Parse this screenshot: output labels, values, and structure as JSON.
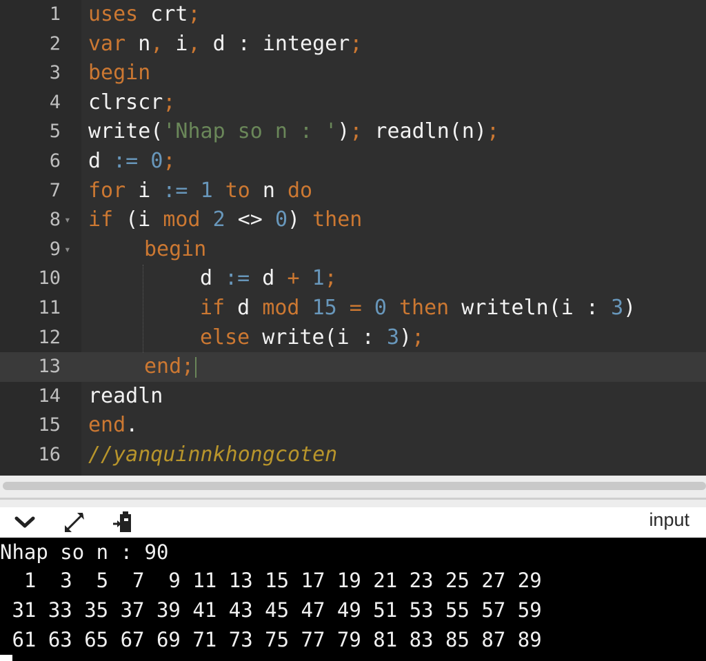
{
  "editor": {
    "lines": [
      {
        "number": "1",
        "fold": "",
        "active": false,
        "indent": 0,
        "tokens": [
          [
            "kw",
            "uses"
          ],
          [
            "plain",
            " crt"
          ],
          [
            "kw",
            ";"
          ]
        ]
      },
      {
        "number": "2",
        "fold": "",
        "active": false,
        "indent": 0,
        "tokens": [
          [
            "kw",
            "var"
          ],
          [
            "plain",
            " n"
          ],
          [
            "kw",
            ","
          ],
          [
            "plain",
            " i"
          ],
          [
            "kw",
            ","
          ],
          [
            "plain",
            " d : integer"
          ],
          [
            "kw",
            ";"
          ]
        ]
      },
      {
        "number": "3",
        "fold": "",
        "active": false,
        "indent": 0,
        "tokens": [
          [
            "kw",
            "begin"
          ]
        ]
      },
      {
        "number": "4",
        "fold": "",
        "active": false,
        "indent": 0,
        "tokens": [
          [
            "plain",
            "clrscr"
          ],
          [
            "kw",
            ";"
          ]
        ]
      },
      {
        "number": "5",
        "fold": "",
        "active": false,
        "indent": 0,
        "tokens": [
          [
            "plain",
            "write("
          ],
          [
            "str",
            "'Nhap so n : '"
          ],
          [
            "plain",
            ")"
          ],
          [
            "kw",
            ";"
          ],
          [
            "plain",
            " readln(n)"
          ],
          [
            "kw",
            ";"
          ]
        ]
      },
      {
        "number": "6",
        "fold": "",
        "active": false,
        "indent": 0,
        "tokens": [
          [
            "plain",
            "d "
          ],
          [
            "num",
            ":="
          ],
          [
            "plain",
            " "
          ],
          [
            "num",
            "0"
          ],
          [
            "kw",
            ";"
          ]
        ]
      },
      {
        "number": "7",
        "fold": "",
        "active": false,
        "indent": 0,
        "tokens": [
          [
            "kw",
            "for"
          ],
          [
            "plain",
            " i "
          ],
          [
            "num",
            ":="
          ],
          [
            "plain",
            " "
          ],
          [
            "num",
            "1"
          ],
          [
            "plain",
            " "
          ],
          [
            "kw",
            "to"
          ],
          [
            "plain",
            " n "
          ],
          [
            "kw",
            "do"
          ]
        ]
      },
      {
        "number": "8",
        "fold": "▾",
        "active": false,
        "indent": 0,
        "tokens": [
          [
            "kw",
            "if"
          ],
          [
            "plain",
            " (i "
          ],
          [
            "kw",
            "mod"
          ],
          [
            "plain",
            " "
          ],
          [
            "num",
            "2"
          ],
          [
            "plain",
            " <> "
          ],
          [
            "num",
            "0"
          ],
          [
            "plain",
            ") "
          ],
          [
            "kw",
            "then"
          ]
        ]
      },
      {
        "number": "9",
        "fold": "▾",
        "active": false,
        "indent": 1,
        "tokens": [
          [
            "kw",
            "begin"
          ]
        ]
      },
      {
        "number": "10",
        "fold": "",
        "active": false,
        "indent": 2,
        "tokens": [
          [
            "plain",
            "d "
          ],
          [
            "num",
            ":="
          ],
          [
            "plain",
            " d "
          ],
          [
            "kw",
            "+"
          ],
          [
            "plain",
            " "
          ],
          [
            "num",
            "1"
          ],
          [
            "kw",
            ";"
          ]
        ]
      },
      {
        "number": "11",
        "fold": "",
        "active": false,
        "indent": 2,
        "tokens": [
          [
            "kw",
            "if"
          ],
          [
            "plain",
            " d "
          ],
          [
            "kw",
            "mod"
          ],
          [
            "plain",
            " "
          ],
          [
            "num",
            "15"
          ],
          [
            "plain",
            " "
          ],
          [
            "kw",
            "="
          ],
          [
            "plain",
            " "
          ],
          [
            "num",
            "0"
          ],
          [
            "plain",
            " "
          ],
          [
            "kw",
            "then"
          ],
          [
            "plain",
            " writeln(i : "
          ],
          [
            "num",
            "3"
          ],
          [
            "plain",
            ")"
          ]
        ]
      },
      {
        "number": "12",
        "fold": "",
        "active": false,
        "indent": 2,
        "tokens": [
          [
            "kw",
            "else"
          ],
          [
            "plain",
            " write(i : "
          ],
          [
            "num",
            "3"
          ],
          [
            "plain",
            ")"
          ],
          [
            "kw",
            ";"
          ]
        ]
      },
      {
        "number": "13",
        "fold": "",
        "active": true,
        "indent": 1,
        "tokens": [
          [
            "kw",
            "end;"
          ]
        ]
      },
      {
        "number": "14",
        "fold": "",
        "active": false,
        "indent": 0,
        "tokens": [
          [
            "plain",
            "readln"
          ]
        ]
      },
      {
        "number": "15",
        "fold": "",
        "active": false,
        "indent": 0,
        "tokens": [
          [
            "kw",
            "end"
          ],
          [
            "plain",
            "."
          ]
        ]
      },
      {
        "number": "16",
        "fold": "",
        "active": false,
        "indent": 0,
        "tokens": [
          [
            "cmt",
            "//yanquinnkhongcoten"
          ]
        ]
      }
    ]
  },
  "toolbar": {
    "collapse_icon": "chevron-down-icon",
    "expand_icon": "expand-arrows-icon",
    "paste_icon": "clipboard-paste-icon",
    "input_label": "input"
  },
  "console": {
    "lines": [
      "Nhap so n : 90",
      "  1  3  5  7  9 11 13 15 17 19 21 23 25 27 29",
      " 31 33 35 37 39 41 43 45 47 49 51 53 55 57 59",
      " 61 63 65 67 69 71 73 75 77 79 81 83 85 87 89"
    ]
  },
  "colors": {
    "keyword": "#cc7832",
    "number": "#6897bb",
    "string": "#6a8759",
    "comment": "#b8952b"
  }
}
